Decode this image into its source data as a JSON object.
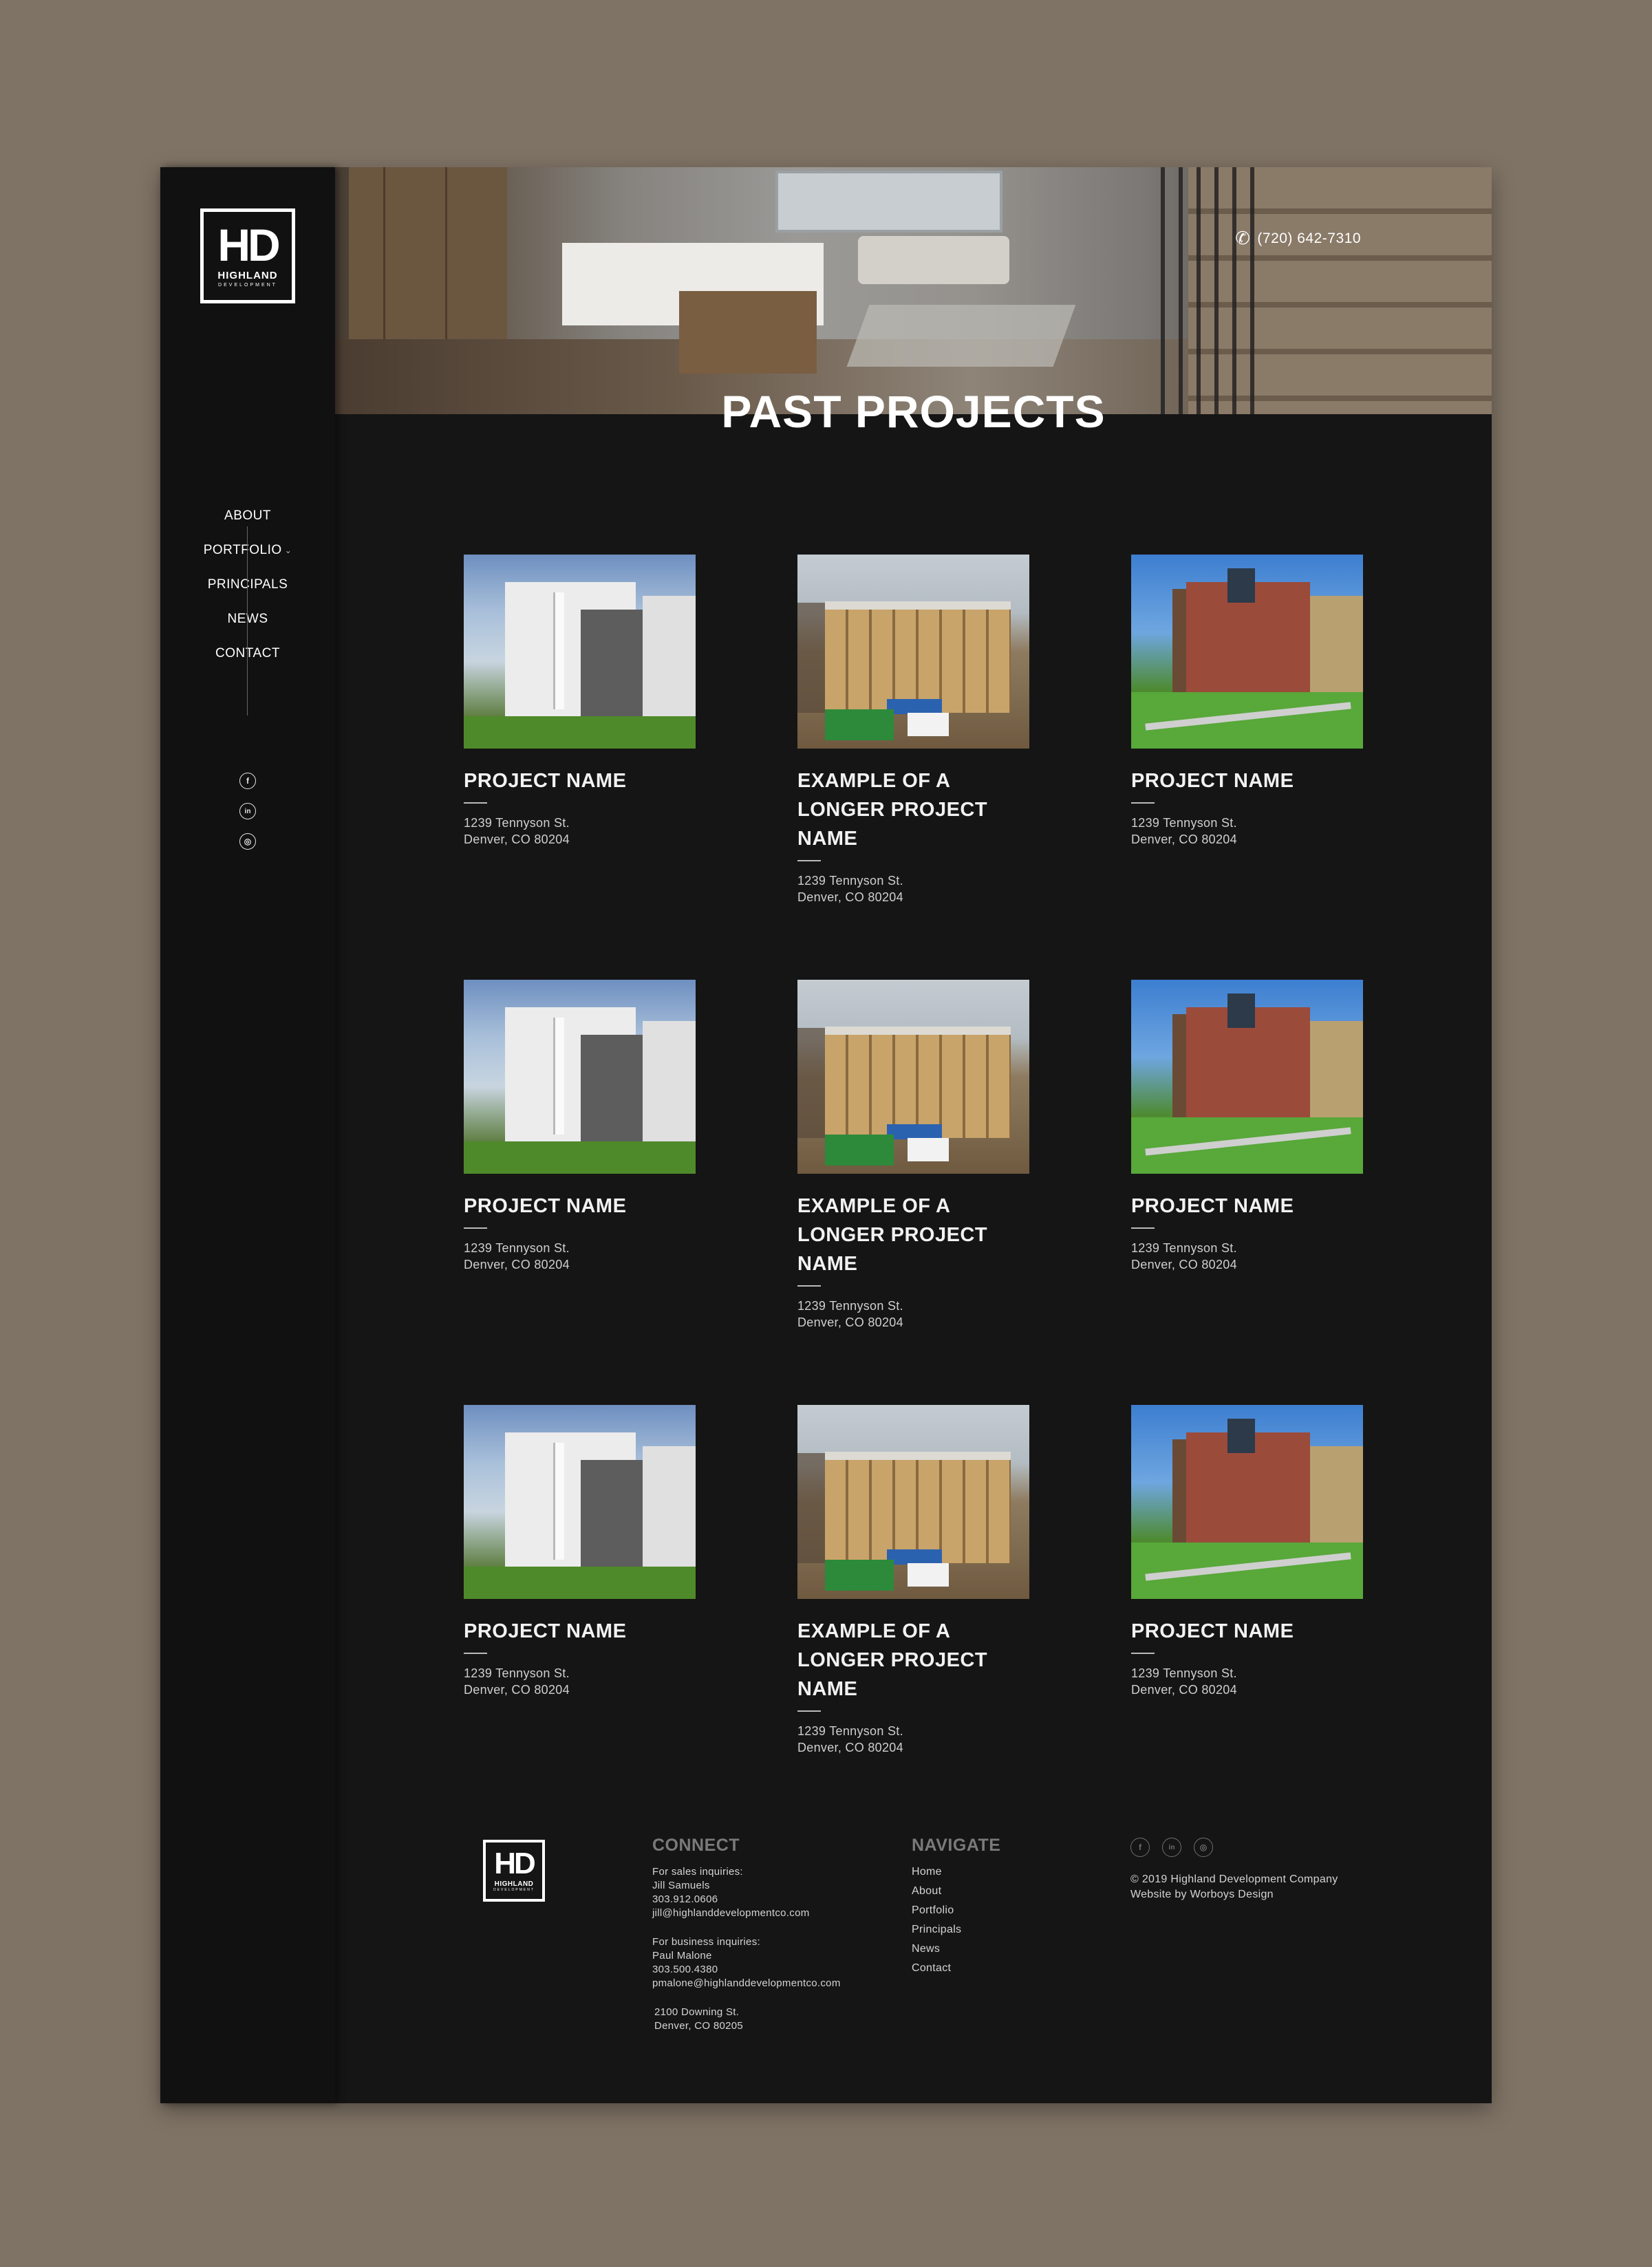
{
  "brand": {
    "mark": "HD",
    "name": "HIGHLAND",
    "sub": "DEVELOPMENT"
  },
  "nav": [
    {
      "label": "ABOUT"
    },
    {
      "label": "PORTFOLIO",
      "has_dropdown": true,
      "chevron": "⌄"
    },
    {
      "label": "PRINCIPALS"
    },
    {
      "label": "NEWS"
    },
    {
      "label": "CONTACT"
    }
  ],
  "social_icons": [
    {
      "name": "facebook-icon",
      "glyph": "f"
    },
    {
      "name": "linkedin-icon",
      "glyph": "in"
    },
    {
      "name": "instagram-icon",
      "glyph": "◎"
    }
  ],
  "header": {
    "phone": "(720) 642-7310",
    "phone_icon": "phone-icon"
  },
  "page_title": "PAST PROJECTS",
  "projects": [
    {
      "name": "PROJECT NAME",
      "addr1": "1239 Tennyson St.",
      "addr2": "Denver, CO 80204",
      "image": "white-modern-building"
    },
    {
      "name": "EXAMPLE OF A LONGER PROJECT NAME",
      "addr1": "1239 Tennyson St.",
      "addr2": "Denver, CO 80204",
      "image": "construction-site"
    },
    {
      "name": "PROJECT NAME",
      "addr1": "1239 Tennyson St.",
      "addr2": "Denver, CO 80204",
      "image": "brick-house"
    },
    {
      "name": "PROJECT NAME",
      "addr1": "1239 Tennyson St.",
      "addr2": "Denver, CO 80204",
      "image": "white-modern-building"
    },
    {
      "name": "EXAMPLE OF A LONGER PROJECT NAME",
      "addr1": "1239 Tennyson St.",
      "addr2": "Denver, CO 80204",
      "image": "construction-site"
    },
    {
      "name": "PROJECT NAME",
      "addr1": "1239 Tennyson St.",
      "addr2": "Denver, CO 80204",
      "image": "brick-house"
    },
    {
      "name": "PROJECT NAME",
      "addr1": "1239 Tennyson St.",
      "addr2": "Denver, CO 80204",
      "image": "white-modern-building"
    },
    {
      "name": "EXAMPLE OF A LONGER PROJECT NAME",
      "addr1": "1239 Tennyson St.",
      "addr2": "Denver, CO 80204",
      "image": "construction-site"
    },
    {
      "name": "PROJECT NAME",
      "addr1": "1239 Tennyson St.",
      "addr2": "Denver, CO 80204",
      "image": "brick-house"
    }
  ],
  "footer": {
    "connect": {
      "title": "CONNECT",
      "sales_label": "For sales inquiries:",
      "sales_name": "Jill Samuels",
      "sales_phone": "303.912.0606",
      "sales_email": "jill@highlanddevelopmentco.com",
      "business_label": "For business inquiries:",
      "business_name": "Paul Malone",
      "business_phone": "303.500.4380",
      "business_email": "pmalone@highlanddevelopmentco.com",
      "address1": "2100 Downing St.",
      "address2": "Denver, CO 80205"
    },
    "navigate": {
      "title": "NAVIGATE",
      "links": [
        "Home",
        "About",
        "Portfolio",
        "Principals",
        "News",
        "Contact"
      ]
    },
    "copyright": "© 2019 Highland Development Company",
    "credit": "Website by Worboys Design"
  },
  "colors": {
    "backdrop": "#7f7365",
    "page": "#151515",
    "sidebar": "#111111",
    "text": "#e6e6e6",
    "muted": "#7a7a7a"
  }
}
